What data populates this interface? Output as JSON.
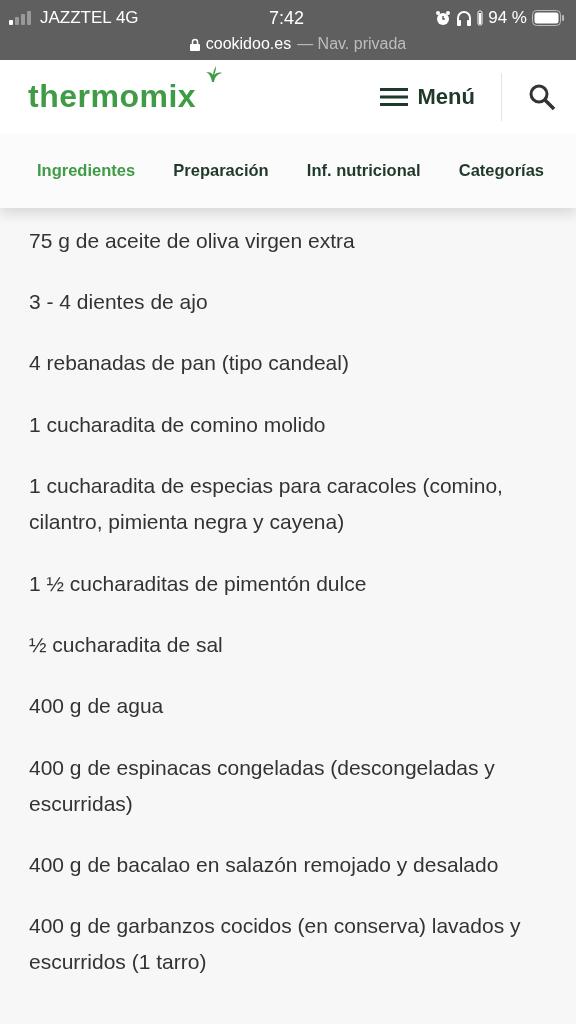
{
  "status_bar": {
    "carrier": "JAZZTEL 4G",
    "time": "7:42",
    "battery": "94 %",
    "url": "cookidoo.es",
    "url_note": "— Nav. privada"
  },
  "header": {
    "logo": "thermomix",
    "menu": "Menú"
  },
  "tabs": [
    {
      "label": "Ingredientes",
      "selected": true
    },
    {
      "label": "Preparación",
      "selected": false
    },
    {
      "label": "Inf. nutricional",
      "selected": false
    },
    {
      "label": "Categorías",
      "selected": false
    }
  ],
  "ingredients": [
    "75 g de aceite de oliva virgen extra",
    "3 - 4 dientes de ajo",
    "4 rebanadas de pan (tipo candeal)",
    "1 cucharadita de comino molido",
    "1 cucharadita de especias para caracoles (comino, cilantro, pimienta negra y cayena)",
    "1 ½ cucharaditas de pimentón dulce",
    "½ cucharadita de sal",
    "400 g de agua",
    "400 g de espinacas congeladas (descongeladas y escurridas)",
    "400 g de bacalao en salazón remojado y desalado",
    "400 g de garbanzos cocidos (en conserva) lavados y escurridos (1 tarro)"
  ]
}
